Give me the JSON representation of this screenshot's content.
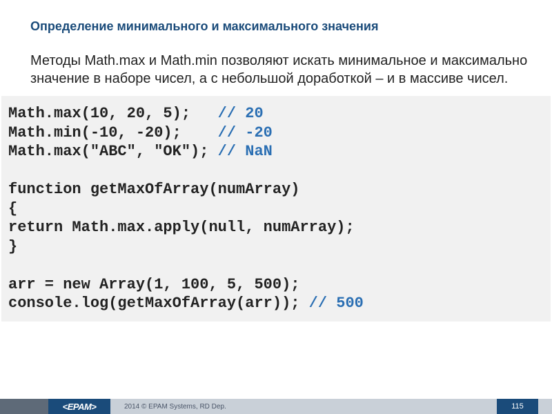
{
  "title": "Определение минимального и максимального значения",
  "description": "Методы Math.max и Math.min позволяют искать минимальное и максимально значение в наборе чисел, а с небольшой доработкой – и в массиве чисел.",
  "code": {
    "l1a": "Math.max(10, 20, 5);   ",
    "l1c": "// 20",
    "l2a": "Math.min(-10, -20);    ",
    "l2c": "// -20",
    "l3a": "Math.max(\"ABC\", \"OK\"); ",
    "l3c": "// NaN",
    "blank1": " ",
    "l4": "function getMaxOfArray(numArray)",
    "l5": "{",
    "l6": "return Math.max.apply(null, numArray);",
    "l7": "}",
    "blank2": " ",
    "l8": "arr = new Array(1, 100, 5, 500);",
    "l9a": "console.log(getMaxOfArray(arr)); ",
    "l9c": "// 500"
  },
  "footer": {
    "logo": "<EPAM>",
    "copyright": "2014 © EPAM Systems, RD Dep.",
    "page": "115"
  }
}
